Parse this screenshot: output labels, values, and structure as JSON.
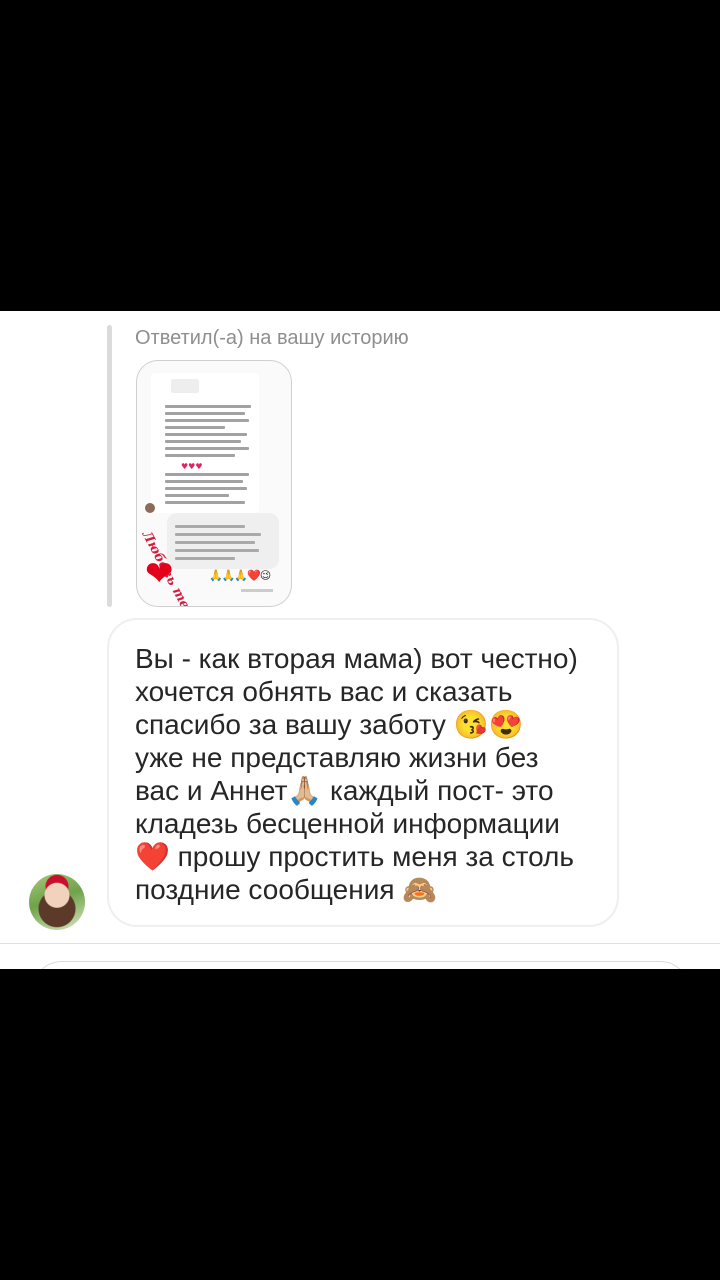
{
  "reply": {
    "caption": "Ответил(-а) на вашу историю",
    "story_sticker": "Любовь творит чудеса",
    "story_emojis": "🙏🙏🙏❤️😉"
  },
  "message": {
    "text": "Вы - как вторая мама) вот честно)\nхочется обнять вас и сказать\nспасибо за вашу заботу 😘😍\nуже не представляю жизни без\nвас и Аннет🙏🏼 каждый пост- это\nкладезь бесценной информации\n❤️ прошу простить меня за столь\nпоздние сообщения 🙈"
  },
  "icons": {
    "story_heart": "❤"
  }
}
